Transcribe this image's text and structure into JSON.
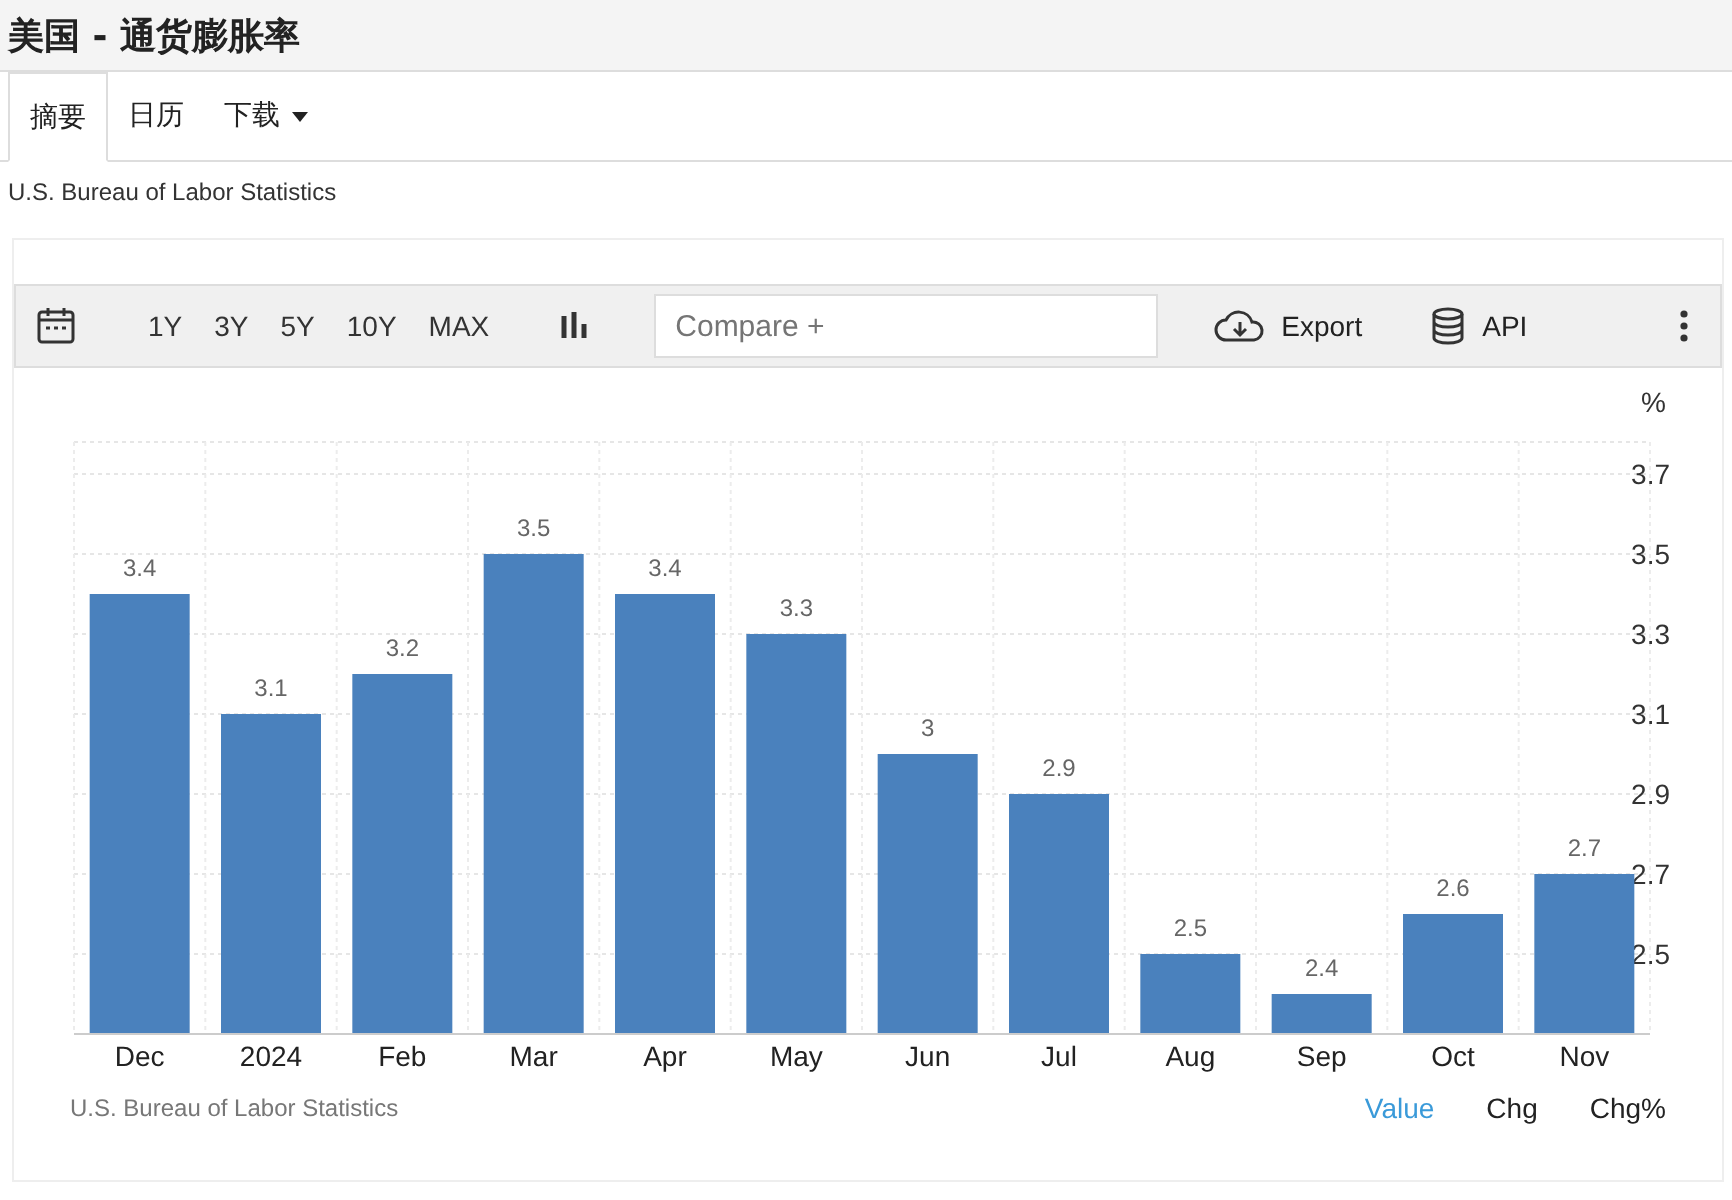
{
  "title": "美国 - 通货膨胀率",
  "tabs": [
    {
      "label": "摘要",
      "selected": true
    },
    {
      "label": "日历",
      "selected": false
    },
    {
      "label": "下载",
      "selected": false,
      "dropdown": true
    }
  ],
  "source": "U.S. Bureau of Labor Statistics",
  "toolbar": {
    "ranges": [
      "1Y",
      "3Y",
      "5Y",
      "10Y",
      "MAX"
    ],
    "compare": {
      "placeholder": "Compare +"
    },
    "export": "Export",
    "api": "API"
  },
  "chart_data": {
    "type": "bar",
    "ylabel": "%",
    "categories": [
      "Dec",
      "2024",
      "Feb",
      "Mar",
      "Apr",
      "May",
      "Jun",
      "Jul",
      "Aug",
      "Sep",
      "Oct",
      "Nov"
    ],
    "grid": true,
    "series": [
      {
        "color": "#4a81bd",
        "values": [
          3.4,
          3.1,
          3.2,
          3.5,
          3.4,
          3.3,
          3,
          2.9,
          2.5,
          2.4,
          2.6,
          2.7
        ]
      }
    ],
    "value_labels": [
      "3.4",
      "3.1",
      "3.2",
      "3.5",
      "3.4",
      "3.3",
      "3",
      "2.9",
      "2.5",
      "2.4",
      "2.6",
      "2.7"
    ],
    "ylim": [
      2.3,
      3.78
    ],
    "yticks": [
      2.5,
      2.7,
      2.9,
      3.1,
      3.3,
      3.5,
      3.7
    ]
  },
  "chart_source": "U.S. Bureau of Labor Statistics",
  "modes": [
    {
      "label": "Value",
      "selected": true
    },
    {
      "label": "Chg",
      "selected": false
    },
    {
      "label": "Chg%",
      "selected": false
    }
  ]
}
